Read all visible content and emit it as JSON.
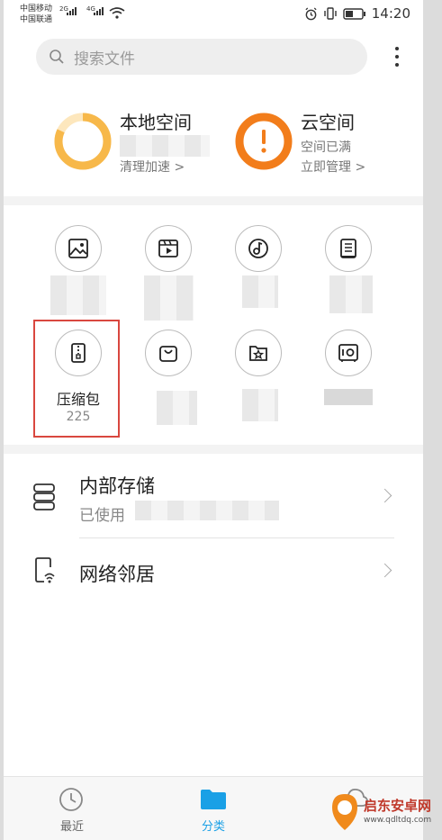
{
  "status_bar": {
    "carrier1": "中国移动",
    "carrier2": "中国联通",
    "net1": "2G",
    "net2": "4G",
    "time": "14:20"
  },
  "search": {
    "placeholder": "搜索文件"
  },
  "storage": {
    "local": {
      "title": "本地空间",
      "action": "清理加速 >",
      "usage_fraction": 0.82,
      "color": "#f7b84a"
    },
    "cloud": {
      "title": "云空间",
      "status": "空间已满",
      "action": "立即管理 >",
      "color": "#f27d1b"
    }
  },
  "categories": [
    {
      "icon": "image-icon"
    },
    {
      "icon": "video-icon"
    },
    {
      "icon": "music-icon"
    },
    {
      "icon": "document-icon"
    },
    {
      "icon": "archive-icon",
      "label": "压缩包",
      "count": "225"
    },
    {
      "icon": "shopping-bag-icon"
    },
    {
      "icon": "favorite-star-icon"
    },
    {
      "icon": "safe-box-icon"
    }
  ],
  "locations": {
    "internal": {
      "title": "内部存储",
      "subtitle": "已使用"
    },
    "network": {
      "title": "网络邻居"
    }
  },
  "tabs": [
    {
      "label": "最近",
      "active": false
    },
    {
      "label": "分类",
      "active": true
    }
  ],
  "accent": "#1aa0e6",
  "watermark": {
    "line1": "启东安卓网",
    "line2": "www.qdltdq.com"
  }
}
